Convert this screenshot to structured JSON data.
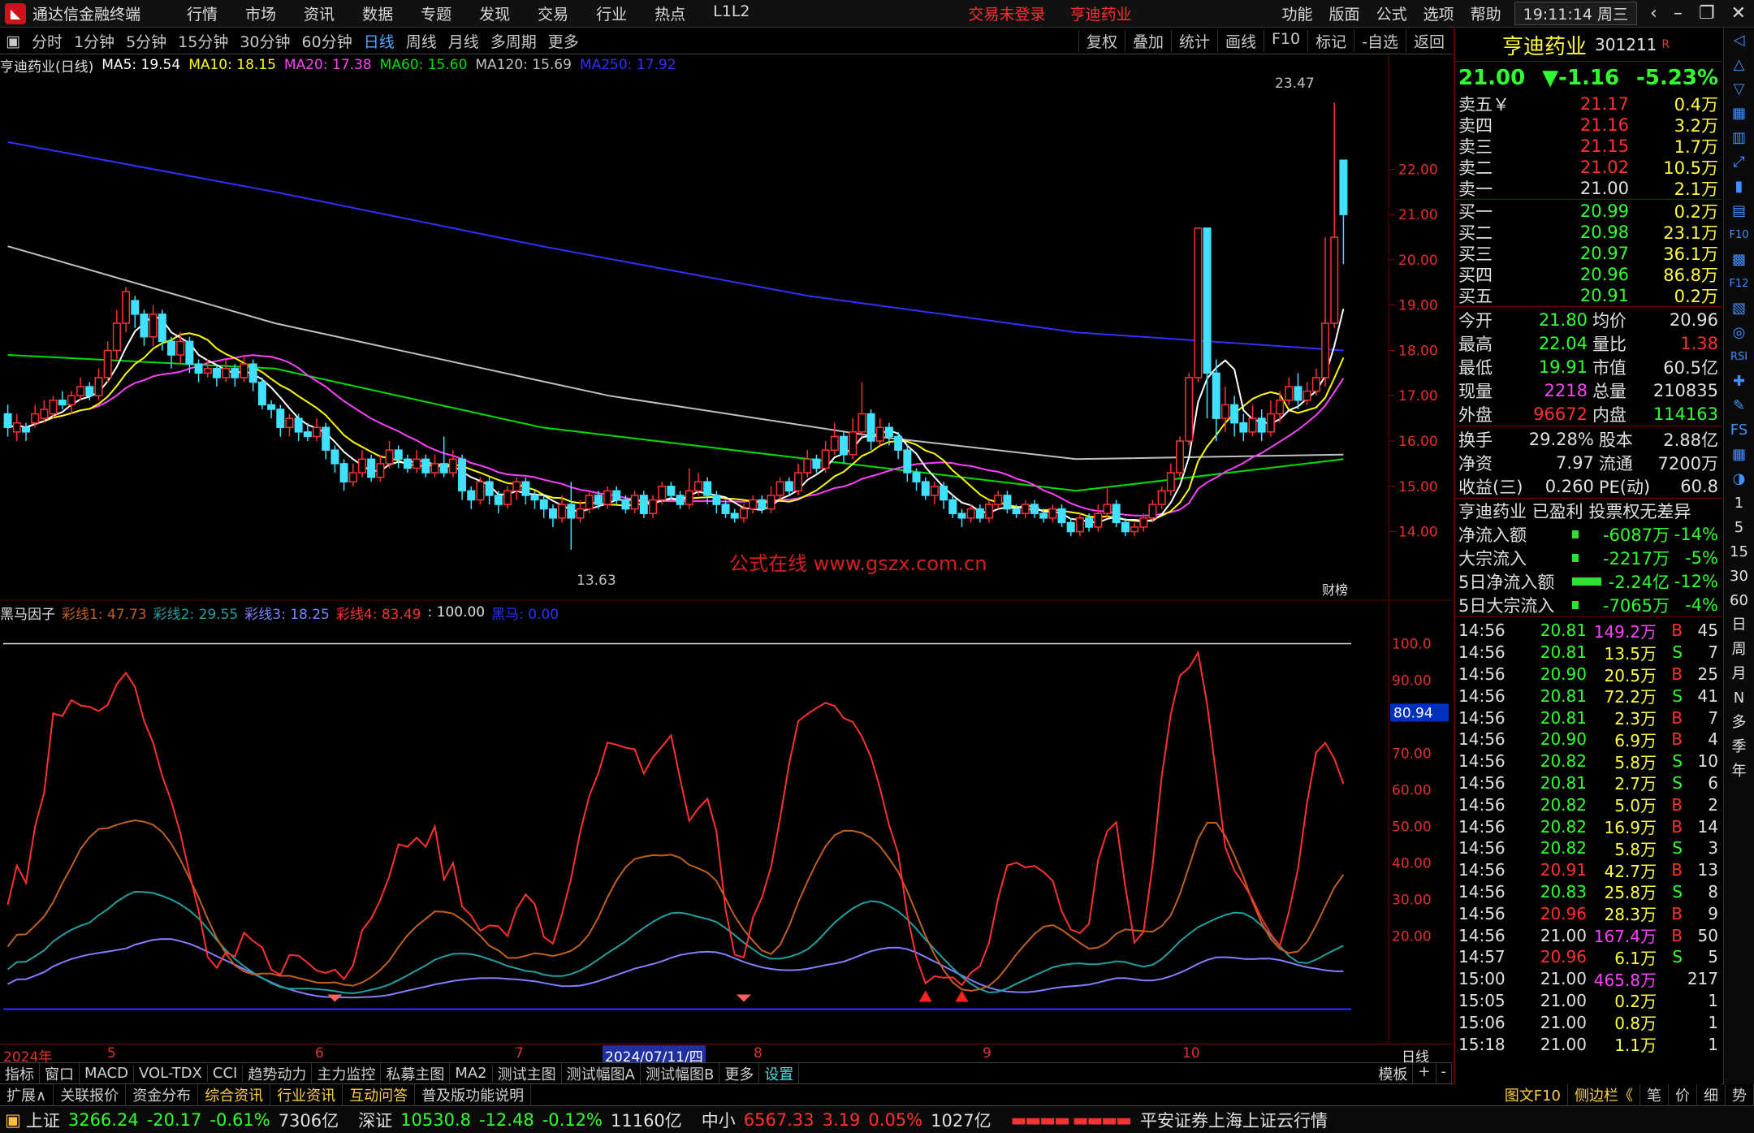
{
  "app": {
    "title": "通达信金融终端",
    "menu": [
      "行情",
      "市场",
      "资讯",
      "数据",
      "专题",
      "发现",
      "交易",
      "行业",
      "热点",
      "L1L2"
    ],
    "warn": [
      "交易未登录",
      "亨迪药业"
    ],
    "rmenu": [
      "功能",
      "版面",
      "公式",
      "选项",
      "帮助"
    ],
    "clock": "19:11:14",
    "weekday": "周三"
  },
  "periods": {
    "items": [
      "分时",
      "1分钟",
      "5分钟",
      "15分钟",
      "30分钟",
      "60分钟",
      "日线",
      "周线",
      "月线",
      "多周期",
      "更多"
    ],
    "selected": "日线",
    "tools": [
      "复权",
      "叠加",
      "统计",
      "画线",
      "F10",
      "标记",
      "-自选",
      "返回"
    ]
  },
  "ma_info": {
    "name": "亨迪药业(日线)",
    "ma5": "MA5: 19.54",
    "ma10": "MA10: 18.15",
    "ma20": "MA20: 17.38",
    "ma60": "MA60: 15.60",
    "ma120": "MA120: 15.69",
    "ma250": "MA250: 17.92"
  },
  "colors": {
    "ma5": "#ffffff",
    "ma10": "#ffff00",
    "ma20": "#ff40ff",
    "ma60": "#00e000",
    "ma120": "#c0c0c0",
    "ma250": "#3030ff",
    "up": "#ff3030",
    "down": "#40e0ff"
  },
  "main_axis": [
    "22.00",
    "21.00",
    "20.00",
    "19.00",
    "18.00",
    "17.00",
    "16.00",
    "15.00",
    "14.00"
  ],
  "annotations": {
    "high": "23.47",
    "low": "13.63",
    "watermark": "公式在线  www.gszx.com.cn",
    "finance_tag": "财榜"
  },
  "indicator": {
    "name": "黑马因子",
    "l1": "彩线1: 47.73",
    "l2": "彩线2: 29.55",
    "l3": "彩线3: 18.25",
    "l4": "彩线4: 83.49",
    "v100": ": 100.00",
    "hm": "黑马: 0.00",
    "axis": [
      "100.0",
      "90.00",
      "80.00",
      "70.00",
      "60.00",
      "50.00",
      "40.00",
      "30.00",
      "20.00"
    ],
    "current": "80.94"
  },
  "timeaxis": {
    "labels": [
      "2024年",
      "5",
      "6",
      "7",
      "2024/07/11/四",
      "8",
      "9",
      "10"
    ],
    "right": "日线"
  },
  "indbar": {
    "items": [
      "指标",
      "窗口",
      "MACD",
      "VOL-TDX",
      "CCI",
      "趋势动力",
      "主力监控",
      "私募主图",
      "MA2",
      "测试主图",
      "测试幅图A",
      "测试幅图B",
      "更多",
      "设置"
    ],
    "right": [
      "模板",
      "+",
      "-"
    ]
  },
  "extbar": {
    "items": [
      "扩展∧",
      "关联报价",
      "资金分布",
      "综合资讯",
      "行业资讯",
      "互动问答",
      "普及版功能说明"
    ],
    "right": [
      "图文F10",
      "侧边栏《",
      "笔",
      "价",
      "细",
      "势"
    ]
  },
  "status": {
    "sh": [
      "上证",
      "3266.24",
      "-20.17",
      "-0.61%",
      "7306亿"
    ],
    "sz": [
      "深证",
      "10530.8",
      "-12.48",
      "-0.12%",
      "11160亿"
    ],
    "zx": [
      "中小",
      "6567.33",
      "3.19",
      "0.05%",
      "1027亿"
    ],
    "broker": "平安证券上海上证云行情"
  },
  "quote": {
    "name": "亨迪药业",
    "code": "301211",
    "r": "R",
    "price": "21.00",
    "change": "▼-1.16",
    "pct": "-5.23%",
    "asks": [
      [
        "卖五￥",
        "21.17",
        "0.4万"
      ],
      [
        "卖四",
        "21.16",
        "3.2万"
      ],
      [
        "卖三",
        "21.15",
        "1.7万"
      ],
      [
        "卖二",
        "21.02",
        "10.5万"
      ],
      [
        "卖一",
        "21.00",
        "2.1万"
      ]
    ],
    "bids": [
      [
        "买一",
        "20.99",
        "0.2万"
      ],
      [
        "买二",
        "20.98",
        "23.1万"
      ],
      [
        "买三",
        "20.97",
        "36.1万"
      ],
      [
        "买四",
        "20.96",
        "86.8万"
      ],
      [
        "买五",
        "20.91",
        "0.2万"
      ]
    ],
    "stats": [
      [
        "今开",
        "21.80",
        "均价",
        "20.96"
      ],
      [
        "最高",
        "22.04",
        "量比",
        "1.38"
      ],
      [
        "最低",
        "19.91",
        "市值",
        "60.5亿"
      ],
      [
        "现量",
        "2218",
        "总量",
        "210835"
      ],
      [
        "外盘",
        "96672",
        "内盘",
        "114163"
      ]
    ],
    "stats2": [
      [
        "换手",
        "29.28%",
        "股本",
        "2.88亿"
      ],
      [
        "净资",
        "7.97",
        "流通",
        "7200万"
      ],
      [
        "收益(三)",
        "0.260",
        "PE(动)",
        "60.8"
      ]
    ],
    "profit": "亨迪药业 已盈利 投票权无差异",
    "flows": [
      [
        "净流入额",
        "-6087万",
        "-14%"
      ],
      [
        "大宗流入",
        "-2217万",
        "-5%"
      ],
      [
        "5日净流入额",
        "-2.24亿",
        "-12%"
      ],
      [
        "5日大宗流入",
        "-7065万",
        "-4%"
      ]
    ],
    "ticks": [
      [
        "14:56",
        "20.81",
        "149.2万",
        "B",
        "45"
      ],
      [
        "14:56",
        "20.81",
        "13.5万",
        "S",
        "7"
      ],
      [
        "14:56",
        "20.90",
        "20.5万",
        "B",
        "25"
      ],
      [
        "14:56",
        "20.81",
        "72.2万",
        "S",
        "41"
      ],
      [
        "14:56",
        "20.81",
        "2.3万",
        "B",
        "7"
      ],
      [
        "14:56",
        "20.90",
        "6.9万",
        "B",
        "4"
      ],
      [
        "14:56",
        "20.82",
        "5.8万",
        "S",
        "10"
      ],
      [
        "14:56",
        "20.81",
        "2.7万",
        "S",
        "6"
      ],
      [
        "14:56",
        "20.82",
        "5.0万",
        "B",
        "2"
      ],
      [
        "14:56",
        "20.82",
        "16.9万",
        "B",
        "14"
      ],
      [
        "14:56",
        "20.82",
        "5.8万",
        "S",
        "3"
      ],
      [
        "14:56",
        "20.91",
        "42.7万",
        "B",
        "13"
      ],
      [
        "14:56",
        "20.83",
        "25.8万",
        "S",
        "8"
      ],
      [
        "14:56",
        "20.96",
        "28.3万",
        "B",
        "9"
      ],
      [
        "14:56",
        "21.00",
        "167.4万",
        "B",
        "50"
      ],
      [
        "14:57",
        "20.96",
        "6.1万",
        "S",
        "5"
      ],
      [
        "15:00",
        "21.00",
        "465.8万",
        "",
        "217"
      ],
      [
        "15:05",
        "21.00",
        "0.2万",
        "",
        "1"
      ],
      [
        "15:06",
        "21.00",
        "0.8万",
        "",
        "1"
      ],
      [
        "15:18",
        "21.00",
        "1.1万",
        "",
        "1"
      ]
    ]
  },
  "rtool": [
    "◁",
    "△",
    "▽",
    "▦",
    "▥",
    "⤢",
    "▮",
    "▤",
    "F10",
    "▩",
    "F12",
    "▧",
    "◎",
    "RSI",
    "✚",
    "✎",
    "FS",
    "▦",
    "◑",
    "1",
    "5",
    "15",
    "30",
    "60",
    "日",
    "周",
    "月",
    "N",
    "多",
    "季",
    "年"
  ],
  "chart_data": {
    "type": "candlestick",
    "price_range": [
      13.4,
      23.8
    ],
    "candles": [
      [
        16.6,
        16.3,
        16.8,
        16.1
      ],
      [
        16.2,
        16.4,
        16.6,
        16.0
      ],
      [
        16.3,
        16.2,
        16.4,
        16.0
      ],
      [
        16.4,
        16.6,
        16.8,
        16.3
      ],
      [
        16.5,
        16.7,
        16.9,
        16.4
      ],
      [
        16.6,
        16.9,
        17.0,
        16.5
      ],
      [
        16.9,
        16.8,
        17.1,
        16.7
      ],
      [
        16.8,
        17.0,
        17.1,
        16.6
      ],
      [
        17.0,
        17.2,
        17.4,
        16.9
      ],
      [
        17.2,
        17.0,
        17.3,
        16.9
      ],
      [
        17.0,
        17.4,
        17.6,
        16.9
      ],
      [
        17.4,
        18.0,
        18.2,
        17.3
      ],
      [
        18.0,
        18.6,
        18.9,
        17.8
      ],
      [
        18.6,
        19.3,
        19.4,
        18.4
      ],
      [
        19.1,
        18.8,
        19.2,
        18.5
      ],
      [
        18.8,
        18.3,
        18.9,
        18.1
      ],
      [
        18.3,
        18.8,
        19.0,
        18.1
      ],
      [
        18.8,
        18.2,
        18.9,
        18.0
      ],
      [
        18.2,
        17.9,
        18.3,
        17.6
      ],
      [
        17.9,
        18.2,
        18.4,
        17.7
      ],
      [
        18.2,
        17.7,
        18.3,
        17.5
      ],
      [
        17.7,
        17.5,
        17.8,
        17.3
      ],
      [
        17.5,
        17.6,
        17.8,
        17.4
      ],
      [
        17.6,
        17.4,
        17.7,
        17.2
      ],
      [
        17.4,
        17.6,
        17.8,
        17.3
      ],
      [
        17.6,
        17.4,
        17.7,
        17.2
      ],
      [
        17.4,
        17.7,
        17.9,
        17.3
      ],
      [
        17.7,
        17.3,
        17.8,
        17.1
      ],
      [
        17.3,
        16.8,
        17.4,
        16.7
      ],
      [
        16.8,
        16.7,
        16.9,
        16.5
      ],
      [
        16.7,
        16.3,
        16.8,
        16.1
      ],
      [
        16.3,
        16.5,
        16.6,
        16.1
      ],
      [
        16.5,
        16.2,
        16.6,
        16.0
      ],
      [
        16.2,
        16.1,
        16.4,
        16.0
      ],
      [
        16.1,
        16.3,
        16.5,
        16.0
      ],
      [
        16.3,
        15.8,
        16.4,
        15.6
      ],
      [
        15.8,
        15.5,
        15.9,
        15.3
      ],
      [
        15.5,
        15.1,
        15.6,
        14.9
      ],
      [
        15.1,
        15.3,
        15.5,
        15.0
      ],
      [
        15.3,
        15.6,
        15.8,
        15.2
      ],
      [
        15.6,
        15.2,
        15.7,
        15.1
      ],
      [
        15.2,
        15.5,
        15.7,
        15.1
      ],
      [
        15.5,
        15.8,
        16.0,
        15.4
      ],
      [
        15.8,
        15.6,
        15.9,
        15.4
      ],
      [
        15.6,
        15.4,
        15.7,
        15.3
      ],
      [
        15.4,
        15.6,
        15.8,
        15.3
      ],
      [
        15.6,
        15.3,
        15.7,
        15.2
      ],
      [
        15.3,
        15.5,
        15.7,
        15.2
      ],
      [
        15.5,
        15.3,
        16.1,
        15.2
      ],
      [
        15.3,
        15.6,
        15.8,
        15.2
      ],
      [
        15.6,
        14.9,
        15.7,
        14.7
      ],
      [
        14.9,
        14.7,
        15.0,
        14.5
      ],
      [
        14.7,
        15.1,
        15.2,
        14.6
      ],
      [
        15.1,
        14.8,
        15.2,
        14.6
      ],
      [
        14.8,
        14.6,
        14.9,
        14.4
      ],
      [
        14.6,
        14.9,
        15.0,
        14.5
      ],
      [
        14.9,
        15.1,
        15.2,
        14.7
      ],
      [
        15.1,
        14.8,
        15.2,
        14.6
      ],
      [
        14.8,
        14.7,
        14.9,
        14.5
      ],
      [
        14.7,
        14.5,
        14.8,
        14.3
      ],
      [
        14.5,
        14.3,
        14.6,
        14.1
      ],
      [
        14.3,
        14.6,
        14.8,
        14.2
      ],
      [
        14.6,
        14.3,
        15.1,
        13.6
      ],
      [
        14.3,
        14.5,
        14.7,
        14.2
      ],
      [
        14.5,
        14.8,
        14.9,
        14.4
      ],
      [
        14.8,
        14.6,
        14.9,
        14.5
      ],
      [
        14.6,
        14.9,
        15.0,
        14.5
      ],
      [
        14.9,
        14.7,
        15.0,
        14.6
      ],
      [
        14.7,
        14.5,
        14.8,
        14.4
      ],
      [
        14.5,
        14.8,
        14.9,
        14.4
      ],
      [
        14.8,
        14.4,
        14.9,
        14.3
      ],
      [
        14.4,
        14.7,
        14.8,
        14.3
      ],
      [
        14.7,
        15.0,
        15.1,
        14.6
      ],
      [
        15.0,
        14.8,
        15.1,
        14.7
      ],
      [
        14.8,
        14.6,
        14.9,
        14.5
      ],
      [
        14.6,
        14.9,
        15.4,
        14.5
      ],
      [
        14.9,
        15.1,
        15.3,
        14.8
      ],
      [
        15.1,
        14.8,
        15.2,
        14.6
      ],
      [
        14.8,
        14.6,
        14.9,
        14.4
      ],
      [
        14.6,
        14.4,
        14.7,
        14.3
      ],
      [
        14.4,
        14.3,
        14.5,
        14.2
      ],
      [
        14.3,
        14.5,
        14.6,
        14.2
      ],
      [
        14.5,
        14.7,
        14.8,
        14.4
      ],
      [
        14.7,
        14.5,
        14.8,
        14.4
      ],
      [
        14.5,
        14.8,
        15.0,
        14.4
      ],
      [
        14.8,
        15.1,
        15.2,
        14.7
      ],
      [
        15.1,
        14.9,
        15.2,
        14.8
      ],
      [
        14.9,
        15.3,
        15.5,
        14.8
      ],
      [
        15.3,
        15.6,
        15.8,
        15.2
      ],
      [
        15.6,
        15.4,
        15.7,
        15.3
      ],
      [
        15.4,
        15.8,
        16.0,
        15.3
      ],
      [
        15.8,
        16.1,
        16.4,
        15.7
      ],
      [
        16.1,
        15.7,
        16.2,
        15.5
      ],
      [
        15.7,
        16.2,
        16.5,
        15.6
      ],
      [
        16.2,
        16.6,
        17.3,
        16.1
      ],
      [
        16.6,
        16.0,
        16.7,
        15.8
      ],
      [
        16.0,
        16.3,
        16.5,
        15.9
      ],
      [
        16.3,
        16.1,
        16.4,
        15.9
      ],
      [
        16.1,
        15.8,
        16.2,
        15.6
      ],
      [
        15.8,
        15.3,
        15.9,
        15.1
      ],
      [
        15.3,
        15.1,
        15.4,
        14.9
      ],
      [
        15.1,
        14.8,
        15.2,
        14.7
      ],
      [
        14.8,
        15.0,
        15.1,
        14.6
      ],
      [
        15.0,
        14.7,
        15.1,
        14.5
      ],
      [
        14.7,
        14.4,
        14.8,
        14.3
      ],
      [
        14.4,
        14.3,
        14.5,
        14.1
      ],
      [
        14.3,
        14.5,
        14.6,
        14.2
      ],
      [
        14.5,
        14.3,
        14.6,
        14.2
      ],
      [
        14.3,
        14.6,
        14.7,
        14.2
      ],
      [
        14.6,
        14.8,
        14.9,
        14.5
      ],
      [
        14.8,
        14.5,
        14.9,
        14.4
      ],
      [
        14.5,
        14.4,
        14.6,
        14.3
      ],
      [
        14.4,
        14.6,
        14.7,
        14.3
      ],
      [
        14.6,
        14.4,
        14.7,
        14.3
      ],
      [
        14.4,
        14.3,
        14.5,
        14.2
      ],
      [
        14.3,
        14.5,
        14.6,
        14.2
      ],
      [
        14.5,
        14.2,
        14.6,
        14.1
      ],
      [
        14.2,
        14.0,
        14.3,
        13.9
      ],
      [
        14.0,
        14.3,
        14.4,
        13.9
      ],
      [
        14.3,
        14.1,
        14.4,
        14.0
      ],
      [
        14.1,
        14.4,
        14.6,
        14.0
      ],
      [
        14.4,
        14.6,
        15.0,
        14.3
      ],
      [
        14.6,
        14.2,
        14.7,
        14.1
      ],
      [
        14.2,
        14.0,
        14.3,
        13.9
      ],
      [
        14.0,
        14.1,
        14.2,
        13.9
      ],
      [
        14.1,
        14.3,
        14.4,
        14.0
      ],
      [
        14.3,
        14.6,
        14.7,
        14.2
      ],
      [
        14.6,
        14.9,
        15.0,
        14.5
      ],
      [
        14.9,
        15.3,
        15.5,
        14.8
      ],
      [
        15.3,
        16.0,
        16.1,
        15.2
      ],
      [
        16.0,
        17.4,
        17.5,
        15.9
      ],
      [
        17.4,
        20.7,
        20.7,
        17.3
      ],
      [
        20.7,
        17.5,
        18.6,
        16.5
      ],
      [
        17.5,
        16.5,
        17.8,
        16.0
      ],
      [
        16.5,
        16.8,
        17.2,
        16.2
      ],
      [
        16.8,
        16.4,
        17.0,
        16.1
      ],
      [
        16.4,
        16.2,
        16.6,
        16.0
      ],
      [
        16.2,
        16.5,
        16.8,
        16.1
      ],
      [
        16.5,
        16.2,
        16.7,
        16.0
      ],
      [
        16.2,
        16.6,
        16.9,
        16.1
      ],
      [
        16.6,
        16.9,
        17.1,
        16.4
      ],
      [
        16.9,
        17.2,
        17.4,
        16.8
      ],
      [
        17.2,
        16.9,
        17.5,
        16.7
      ],
      [
        16.9,
        17.1,
        17.3,
        16.8
      ],
      [
        17.1,
        17.4,
        17.6,
        17.0
      ],
      [
        17.4,
        18.6,
        20.5,
        17.2
      ],
      [
        18.6,
        20.5,
        23.47,
        18.5
      ],
      [
        22.2,
        21.0,
        22.04,
        19.91
      ]
    ],
    "ma": {
      "ma250": [
        [
          0,
          22.6
        ],
        [
          0.2,
          21.5
        ],
        [
          0.4,
          20.3
        ],
        [
          0.6,
          19.2
        ],
        [
          0.8,
          18.4
        ],
        [
          1,
          18.0
        ]
      ],
      "ma120": [
        [
          0,
          20.3
        ],
        [
          0.2,
          18.6
        ],
        [
          0.45,
          17.0
        ],
        [
          0.65,
          16.1
        ],
        [
          0.8,
          15.6
        ],
        [
          1,
          15.7
        ]
      ],
      "ma60": [
        [
          0,
          17.9
        ],
        [
          0.2,
          17.6
        ],
        [
          0.4,
          16.3
        ],
        [
          0.6,
          15.6
        ],
        [
          0.8,
          14.9
        ],
        [
          1,
          15.6
        ]
      ]
    },
    "indicator_range": [
      -5,
      105
    ]
  }
}
